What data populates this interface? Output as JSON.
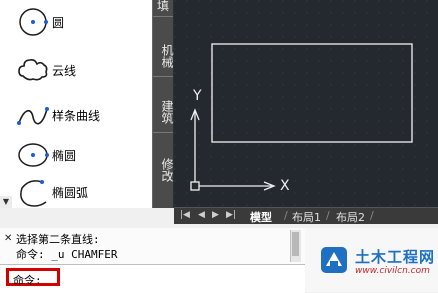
{
  "palette": {
    "tools": [
      {
        "label": "圆",
        "icon": "circle-icon"
      },
      {
        "label": "云线",
        "icon": "cloud-icon"
      },
      {
        "label": "样条曲线",
        "icon": "spline-icon"
      },
      {
        "label": "椭圆",
        "icon": "ellipse-icon"
      },
      {
        "label": "椭圆弧",
        "icon": "elliptical-arc-icon"
      }
    ]
  },
  "vertical_tabs": [
    "填",
    "机械",
    "建筑",
    "修改"
  ],
  "canvas": {
    "y_axis_label": "Y",
    "x_axis_label": "X",
    "background": "#24282f"
  },
  "layout_tabs": {
    "model": "模型",
    "layout1": "布局1",
    "layout2": "布局2"
  },
  "command": {
    "history": [
      "选择第二条直线:",
      "命令: _u CHAMFER"
    ],
    "prompt": "命令:",
    "close_glyph": "✕",
    "highlight_color": "#d40000"
  },
  "watermark": {
    "title": "土木工程网",
    "url": "www.civilcn.com"
  }
}
